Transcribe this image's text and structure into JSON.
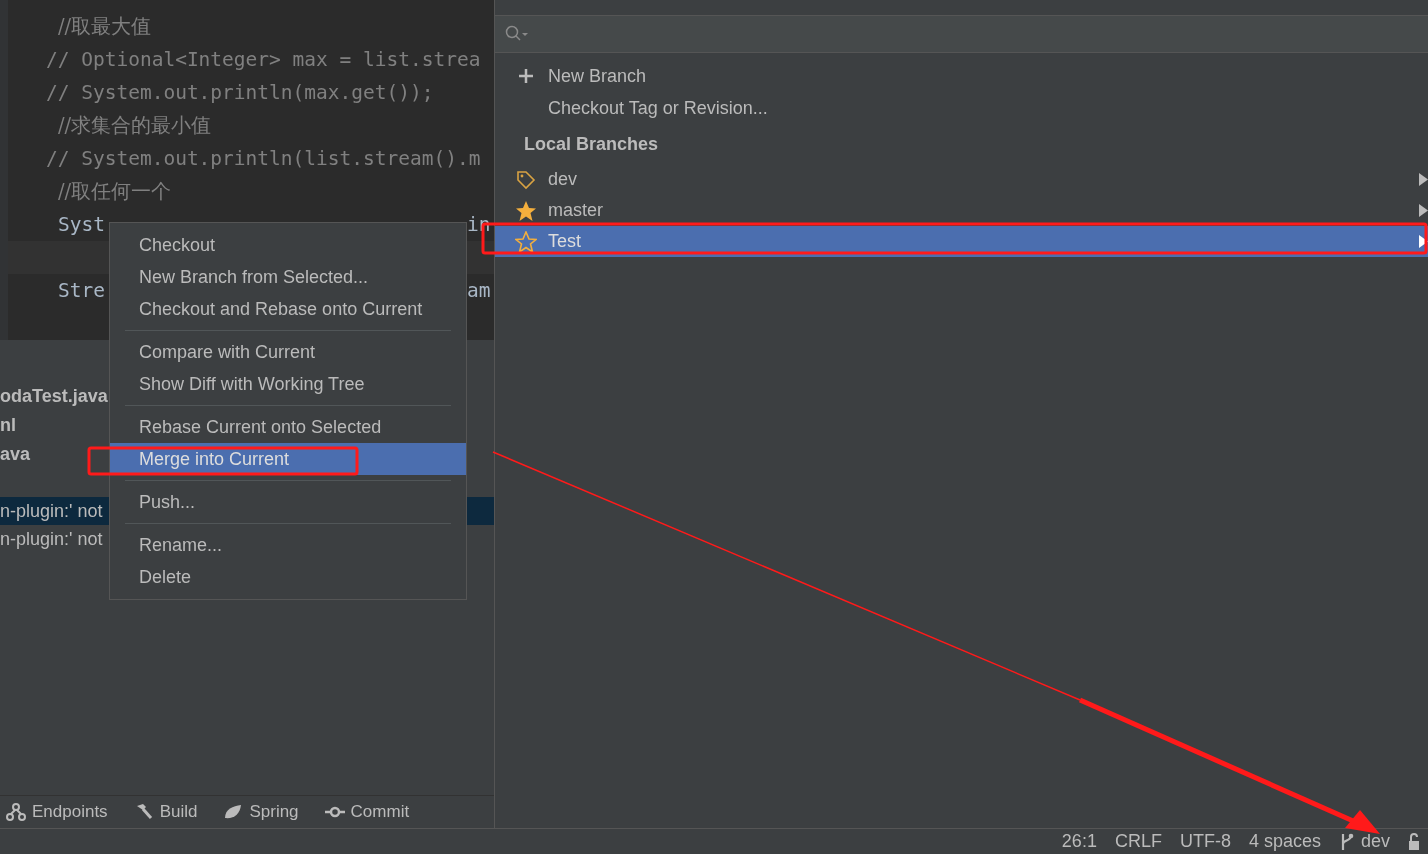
{
  "editor": {
    "lines": [
      {
        "kind": "comment",
        "text": "//取最大值"
      },
      {
        "kind": "commented_code",
        "text": "// Optional<Integer> max = list.strea"
      },
      {
        "kind": "commented_code",
        "text": "// System.out.println(max.get());"
      },
      {
        "kind": "comment",
        "text": "//求集合的最小值"
      },
      {
        "kind": "commented_code",
        "text": "// System.out.println(list.stream().m"
      },
      {
        "kind": "comment",
        "text": "//取任何一个"
      },
      {
        "kind": "code",
        "text": "Syst",
        "tail": "in"
      },
      {
        "kind": "blank",
        "current": true
      },
      {
        "kind": "code",
        "text": "Stre",
        "tail": "am"
      }
    ]
  },
  "lower_panel": {
    "files": [
      "odaTest.java",
      "nl",
      "ava"
    ],
    "messages": [
      {
        "text": "n-plugin:' not",
        "selected": true
      },
      {
        "text": "n-plugin:' not",
        "selected": false
      }
    ]
  },
  "tool_tabs": [
    {
      "label": "Endpoints",
      "kind": "endpoints"
    },
    {
      "label": "Build",
      "kind": "build"
    },
    {
      "label": "Spring",
      "kind": "spring"
    },
    {
      "label": "Commit",
      "kind": "commit"
    }
  ],
  "branches_popup": {
    "actions": [
      {
        "label": "New Branch",
        "kind": "add"
      },
      {
        "label": "Checkout Tag or Revision...",
        "kind": "plain"
      }
    ],
    "section": "Local Branches",
    "branches": [
      {
        "name": "dev",
        "kind": "current",
        "selected": false
      },
      {
        "name": "master",
        "kind": "favorite",
        "selected": false
      },
      {
        "name": "Test",
        "kind": "other",
        "selected": true
      }
    ]
  },
  "context_menu": {
    "groups": [
      [
        {
          "label": "Checkout",
          "selected": false
        },
        {
          "label": "New Branch from Selected...",
          "selected": false
        },
        {
          "label": "Checkout and Rebase onto Current",
          "selected": false
        }
      ],
      [
        {
          "label": "Compare with Current",
          "selected": false
        },
        {
          "label": "Show Diff with Working Tree",
          "selected": false
        }
      ],
      [
        {
          "label": "Rebase Current onto Selected",
          "selected": false
        },
        {
          "label": "Merge into Current",
          "selected": true
        }
      ],
      [
        {
          "label": "Push...",
          "selected": false
        }
      ],
      [
        {
          "label": "Rename...",
          "selected": false
        },
        {
          "label": "Delete",
          "selected": false
        }
      ]
    ]
  },
  "status_bar": {
    "items": [
      "26:1",
      "CRLF",
      "UTF-8",
      "4 spaces"
    ],
    "branch": "dev"
  }
}
